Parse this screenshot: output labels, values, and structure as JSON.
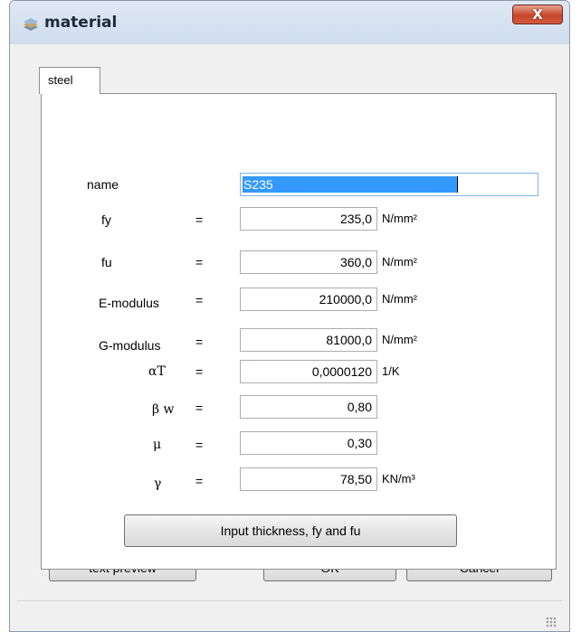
{
  "window": {
    "title": "material",
    "close_glyph": "X",
    "icon": "material-layers-icon"
  },
  "tabs": [
    {
      "label": "steel",
      "active": true
    }
  ],
  "form": {
    "name": {
      "label": "name",
      "value": "S235"
    },
    "fy": {
      "label": "fy",
      "eq": "=",
      "value": "235,0",
      "unit": "N/mm²"
    },
    "fu": {
      "label": "fu",
      "eq": "=",
      "value": "360,0",
      "unit": "N/mm²"
    },
    "e_modulus": {
      "label": "E-modulus",
      "eq": "=",
      "value": "210000,0",
      "unit": "N/mm²"
    },
    "g_modulus": {
      "label": "G-modulus",
      "eq": "=",
      "value": "81000,0",
      "unit": "N/mm²"
    },
    "alpha_t": {
      "label": "αT",
      "eq": "=",
      "value": "0,0000120",
      "unit": "1/K"
    },
    "beta_w": {
      "label": "β w",
      "eq": "=",
      "value": "0,80"
    },
    "mu": {
      "label": "μ",
      "eq": "=",
      "value": "0,30"
    },
    "gamma": {
      "label": "γ",
      "eq": "=",
      "value": "78,50",
      "unit": "KN/m³"
    }
  },
  "buttons": {
    "input_thickness": "Input thickness, fy and fu",
    "text_preview": "text preview",
    "ok": "OK",
    "cancel": "Cancel"
  },
  "colors": {
    "selection": "#3399ff",
    "close_button": "#c7462b",
    "titlebar": "#dfe9f5"
  }
}
